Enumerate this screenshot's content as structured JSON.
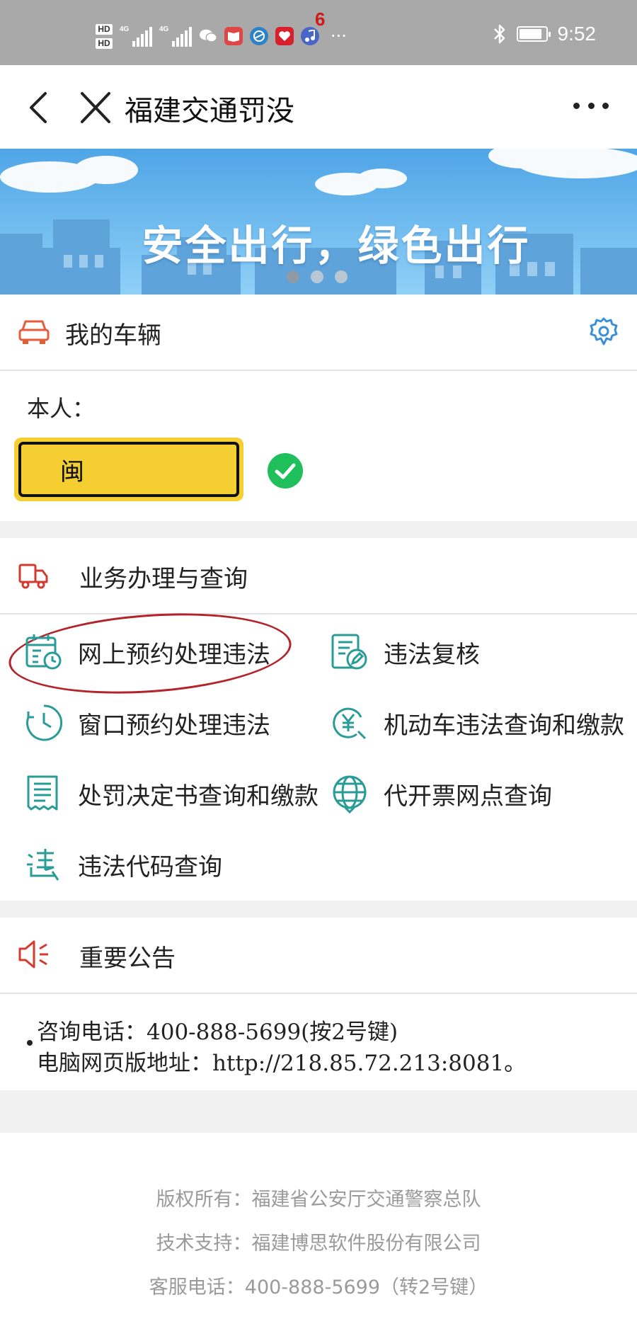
{
  "status_bar": {
    "hd1": "HD",
    "hd2": "HD",
    "net1": "4G",
    "net2": "4G",
    "badge_count": "6",
    "more": "···",
    "time": "9:52"
  },
  "navbar": {
    "title": "福建交通罚没"
  },
  "banner": {
    "slogan": "安全出行，绿色出行",
    "slide_count": 3,
    "active_slide": 1
  },
  "vehicle": {
    "title": "我的车辆",
    "owner_label": "本人：",
    "plate_prefix": "闽"
  },
  "services": {
    "title": "业务办理与查询",
    "items": [
      {
        "label": "网上预约处理违法",
        "icon": "calendar-clock-icon"
      },
      {
        "label": "违法复核",
        "icon": "document-edit-icon"
      },
      {
        "label": "窗口预约处理违法",
        "icon": "clock-icon"
      },
      {
        "label": "机动车违法查询和缴款",
        "icon": "yuan-search-icon"
      },
      {
        "label": "处罚决定书查询和缴款",
        "icon": "receipt-icon"
      },
      {
        "label": "代开票网点查询",
        "icon": "globe-icon"
      },
      {
        "label": "违法代码查询",
        "icon": "code-search-icon"
      }
    ]
  },
  "notice": {
    "title": "重要公告",
    "lines": [
      "咨询电话：400-888-5699(按2号键)",
      "电脑网页版地址：http://218.85.72.213:8081。"
    ]
  },
  "footer": {
    "copyright": "版权所有：福建省公安厅交通警察总队",
    "support": "技术支持：福建博思软件股份有限公司",
    "hotline": "客服电话：400-888-5699（转2号键）"
  },
  "colors": {
    "accent_teal": "#2a9c97",
    "accent_red": "#d23b2f",
    "plate_yellow": "#f5ce32",
    "check_green": "#1fbf5c",
    "gear_blue": "#3a8fd8"
  }
}
